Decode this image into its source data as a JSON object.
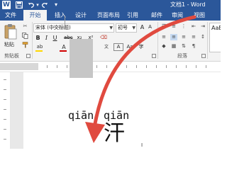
{
  "titlebar": {
    "logo_letter": "W",
    "doc_title": "文档1 - Word",
    "save_icon": "save-icon",
    "undo_icon": "undo-icon",
    "redo_icon": "redo-icon",
    "accent_color": "#2b579a"
  },
  "tabs": [
    "文件",
    "开始",
    "插入",
    "设计",
    "页面布局",
    "引用",
    "邮件",
    "审阅",
    "视图"
  ],
  "active_tab": "开始",
  "ribbon": {
    "clipboard": {
      "paste_label": "粘贴",
      "group_label": "剪贴板"
    },
    "font": {
      "font_name": "宋体 (中文标题)",
      "font_size": "初号",
      "grow": "A",
      "shrink": "A",
      "bold": "B",
      "italic": "I",
      "underline": "U",
      "strike": "abc",
      "subscript": "x₂",
      "superscript": "x²",
      "highlight": "ab",
      "font_color": "A",
      "effects": "A",
      "char_box": "A",
      "case": "Aa",
      "enclose": "字",
      "group_label": "字体"
    },
    "paragraph": {
      "group_label": "段落"
    },
    "styles": {
      "preview": "AaB"
    }
  },
  "document": {
    "pinyin_1": "qiān",
    "pinyin_2": "qiān",
    "character": "汗"
  },
  "annotation": {
    "arrow_color": "#e04a3f"
  }
}
